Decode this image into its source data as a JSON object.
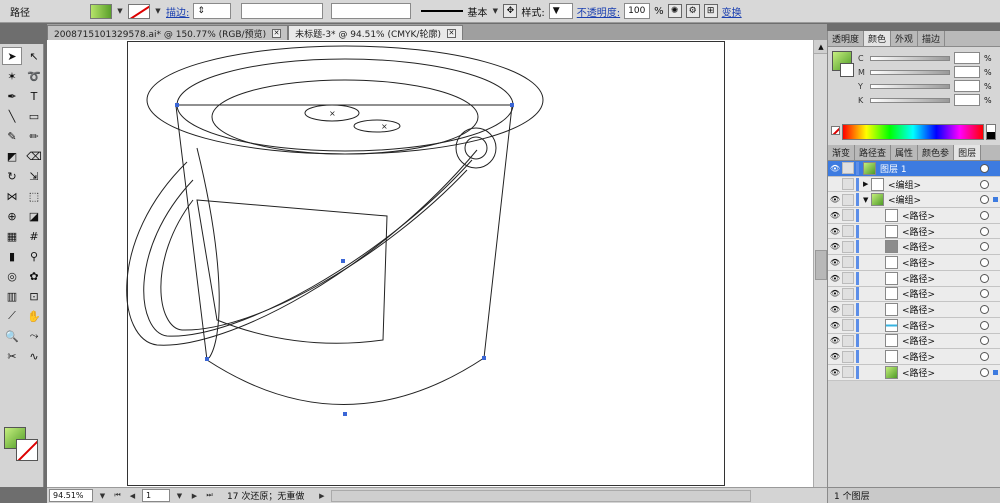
{
  "control_bar": {
    "selection_label": "路径",
    "stroke_link": "描边:",
    "stroke_style_name": "基本",
    "style_label": "样式:",
    "opacity_link": "不透明度:",
    "opacity_value": "100",
    "opacity_unit": "%",
    "transform_link": "变换"
  },
  "document_tabs": [
    {
      "title": "20087151013295​78.ai* @ 150.77% (RGB/预览)"
    },
    {
      "title": "未标题-3* @ 94.51% (CMYK/轮廓)"
    }
  ],
  "status_bar": {
    "zoom": "94.51%",
    "page": "1",
    "undo_status": "17 次还原；无重做"
  },
  "color_panel": {
    "tabs": [
      "透明度",
      "颜色",
      "外观",
      "描边"
    ],
    "channels": [
      "C",
      "M",
      "Y",
      "K"
    ],
    "unit": "%"
  },
  "layers_panel": {
    "tabs": [
      "渐变",
      "路径查",
      "属性",
      "颜色参",
      "图层"
    ],
    "items": [
      {
        "name": "图层 1",
        "thumb": "green"
      },
      {
        "name": "<编组>",
        "thumb": "color"
      },
      {
        "name": "<编组>",
        "thumb": "green"
      },
      {
        "name": "<路径>",
        "thumb": "white"
      },
      {
        "name": "<路径>",
        "thumb": "white"
      },
      {
        "name": "<路径>",
        "thumb": "dark"
      },
      {
        "name": "<路径>",
        "thumb": "white"
      },
      {
        "name": "<路径>",
        "thumb": "white"
      },
      {
        "name": "<路径>",
        "thumb": "white"
      },
      {
        "name": "<路径>",
        "thumb": "white"
      },
      {
        "name": "<路径>",
        "thumb": "cyan"
      },
      {
        "name": "<路径>",
        "thumb": "white"
      },
      {
        "name": "<路径>",
        "thumb": "white"
      },
      {
        "name": "<路径>",
        "thumb": "green"
      }
    ],
    "footer": "1 个图层"
  },
  "colors": {
    "accent": "#3d7be0",
    "anchor": "#3a66d6"
  }
}
